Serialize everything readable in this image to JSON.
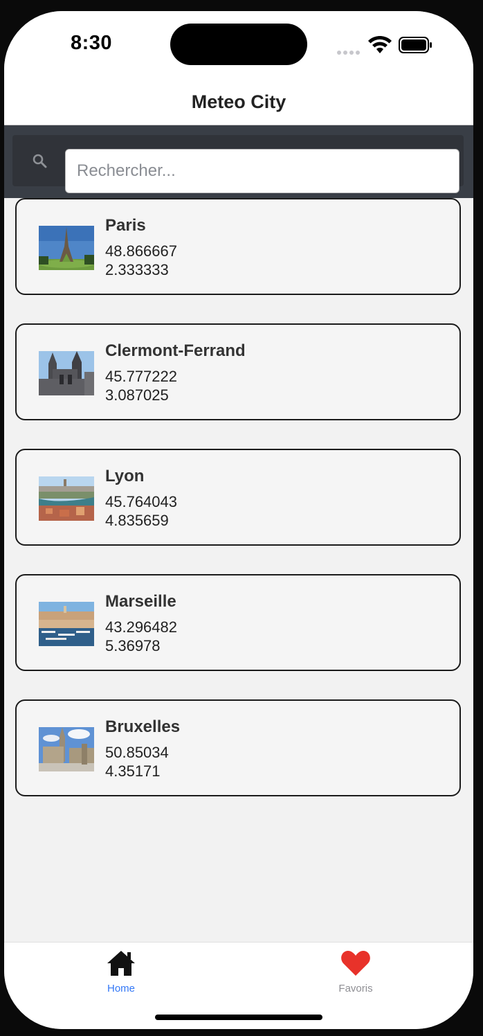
{
  "status_bar": {
    "time": "8:30"
  },
  "header": {
    "title": "Meteo City"
  },
  "search": {
    "placeholder": "Rechercher...",
    "value": ""
  },
  "cities": [
    {
      "name": "Paris",
      "latitude": "48.866667",
      "longitude": "2.333333",
      "image": "eiffel-tower-photo"
    },
    {
      "name": "Clermont-Ferrand",
      "latitude": "45.777222",
      "longitude": "3.087025",
      "image": "cathedral-photo"
    },
    {
      "name": "Lyon",
      "latitude": "45.764043",
      "longitude": "4.835659",
      "image": "lyon-riverside-photo"
    },
    {
      "name": "Marseille",
      "latitude": "43.296482",
      "longitude": "5.36978",
      "image": "marseille-port-photo"
    },
    {
      "name": "Bruxelles",
      "latitude": "50.85034",
      "longitude": "4.35171",
      "image": "grand-place-photo"
    }
  ],
  "tab_bar": {
    "tabs": [
      {
        "label": "Home",
        "icon": "home-icon",
        "active": true
      },
      {
        "label": "Favoris",
        "icon": "heart-icon",
        "active": false
      }
    ]
  },
  "colors": {
    "accent": "#3478f6",
    "favorite": "#e8322a",
    "search_bar_bg": "#393e46",
    "card_border": "#1b1b1b"
  }
}
